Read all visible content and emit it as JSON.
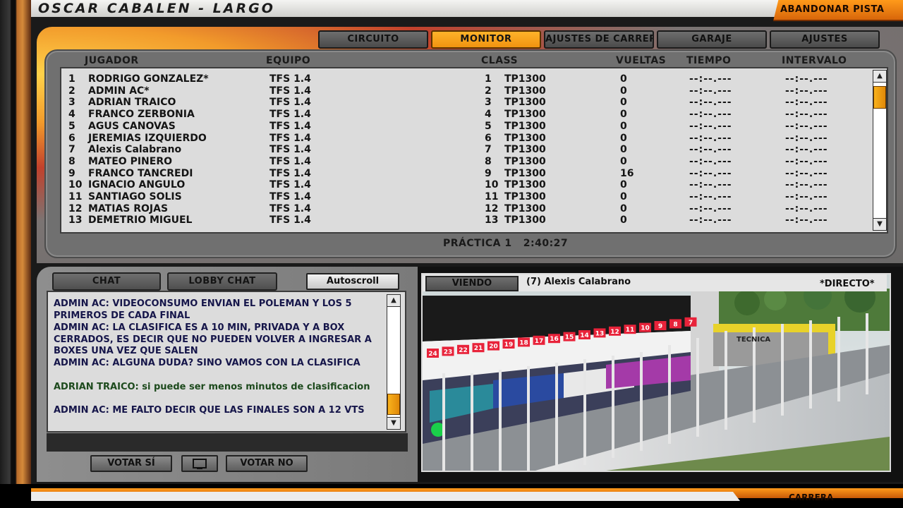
{
  "window": {
    "title": "OSCAR CABALEN - LARGO",
    "abandon_label": "ABANDONAR PISTA"
  },
  "tabs": [
    {
      "label": "CIRCUITO",
      "active": false
    },
    {
      "label": "MONITOR",
      "active": true
    },
    {
      "label": "AJUSTES DE CARRERA",
      "active": false
    },
    {
      "label": "GARAJE",
      "active": false
    },
    {
      "label": "AJUSTES",
      "active": false
    }
  ],
  "table": {
    "headers": {
      "player": "JUGADOR",
      "team": "EQUIPO",
      "class": "CLASS",
      "laps": "VUELTAS",
      "time": "TIEMPO",
      "interval": "INTERVALO"
    },
    "rows": [
      {
        "pos": "1",
        "name": "RODRIGO GONZALEZ*",
        "team": "TFS 1.4",
        "class_pos": "1",
        "class": "TP1300",
        "laps": "0",
        "time": "--:--.---",
        "interval": "--:--.---"
      },
      {
        "pos": "2",
        "name": "ADMIN AC*",
        "team": "TFS 1.4",
        "class_pos": "2",
        "class": "TP1300",
        "laps": "0",
        "time": "--:--.---",
        "interval": "--:--.---"
      },
      {
        "pos": "3",
        "name": "ADRIAN TRAICO",
        "team": "TFS 1.4",
        "class_pos": "3",
        "class": "TP1300",
        "laps": "0",
        "time": "--:--.---",
        "interval": "--:--.---"
      },
      {
        "pos": "4",
        "name": "FRANCO ZERBONIA",
        "team": "TFS 1.4",
        "class_pos": "4",
        "class": "TP1300",
        "laps": "0",
        "time": "--:--.---",
        "interval": "--:--.---"
      },
      {
        "pos": "5",
        "name": "AGUS CANOVAS",
        "team": "TFS 1.4",
        "class_pos": "5",
        "class": "TP1300",
        "laps": "0",
        "time": "--:--.---",
        "interval": "--:--.---"
      },
      {
        "pos": "6",
        "name": "JEREMIAS IZQUIERDO",
        "team": "TFS 1.4",
        "class_pos": "6",
        "class": "TP1300",
        "laps": "0",
        "time": "--:--.---",
        "interval": "--:--.---"
      },
      {
        "pos": "7",
        "name": "Alexis Calabrano",
        "team": "TFS 1.4",
        "class_pos": "7",
        "class": "TP1300",
        "laps": "0",
        "time": "--:--.---",
        "interval": "--:--.---"
      },
      {
        "pos": "8",
        "name": "MATEO PINERO",
        "team": "TFS 1.4",
        "class_pos": "8",
        "class": "TP1300",
        "laps": "0",
        "time": "--:--.---",
        "interval": "--:--.---"
      },
      {
        "pos": "9",
        "name": "FRANCO TANCREDI",
        "team": "TFS 1.4",
        "class_pos": "9",
        "class": "TP1300",
        "laps": "16",
        "time": "--:--.---",
        "interval": "--:--.---"
      },
      {
        "pos": "10",
        "name": "IGNACIO ANGULO",
        "team": "TFS 1.4",
        "class_pos": "10",
        "class": "TP1300",
        "laps": "0",
        "time": "--:--.---",
        "interval": "--:--.---"
      },
      {
        "pos": "11",
        "name": "SANTIAGO SOLIS",
        "team": "TFS 1.4",
        "class_pos": "11",
        "class": "TP1300",
        "laps": "0",
        "time": "--:--.---",
        "interval": "--:--.---"
      },
      {
        "pos": "12",
        "name": "MATIAS ROJAS",
        "team": "TFS 1.4",
        "class_pos": "12",
        "class": "TP1300",
        "laps": "0",
        "time": "--:--.---",
        "interval": "--:--.---"
      },
      {
        "pos": "13",
        "name": "DEMETRIO MIGUEL",
        "team": "TFS 1.4",
        "class_pos": "13",
        "class": "TP1300",
        "laps": "0",
        "time": "--:--.---",
        "interval": "--:--.---"
      }
    ]
  },
  "session": {
    "label": "PRÁCTICA 1",
    "time": "2:40:27"
  },
  "chat": {
    "tab_chat": "CHAT",
    "tab_lobby": "LOBBY CHAT",
    "autoscroll": "Autoscroll",
    "messages": [
      {
        "text": "ADMIN AC: VIDEOCONSUMO ENVIAN EL POLEMAN Y LOS 5 PRIMEROS DE CADA FINAL",
        "color": "blue"
      },
      {
        "text": "ADMIN AC: LA CLASIFICA ES A 10 MIN, PRIVADA Y A BOX CERRADOS, ES DECIR QUE NO PUEDEN VOLVER A INGRESAR A BOXES UNA VEZ QUE SALEN",
        "color": "blue"
      },
      {
        "text": "ADMIN AC: ALGUNA DUDA? SINO VAMOS CON LA CLASIFICA",
        "color": "blue"
      },
      {
        "text": "ADRIAN TRAICO: si puede ser menos minutos de clasificacion",
        "color": "green"
      },
      {
        "text": "ADMIN AC: ME FALTO DECIR QUE LAS FINALES SON A 12 VTS",
        "color": "blue"
      }
    ]
  },
  "vote": {
    "yes": "VOTAR SÍ",
    "no": "VOTAR NO"
  },
  "camera": {
    "viewing_label": "VIENDO",
    "driver": "(7) Alexis Calabrano",
    "mode": "*DIRECTO*",
    "sign_text": "TECNICA",
    "pit_numbers": [
      "24",
      "23",
      "22",
      "21",
      "20",
      "19",
      "18",
      "17",
      "16",
      "15",
      "14",
      "13",
      "12",
      "11",
      "10",
      "9",
      "8",
      "7"
    ]
  },
  "footer": {
    "right_label": "CARRERA"
  },
  "colors": {
    "accent": "#f5a00f",
    "panel": "#dcdcdc",
    "chat_blue": "#16164a",
    "chat_green": "#1d4a1d"
  }
}
